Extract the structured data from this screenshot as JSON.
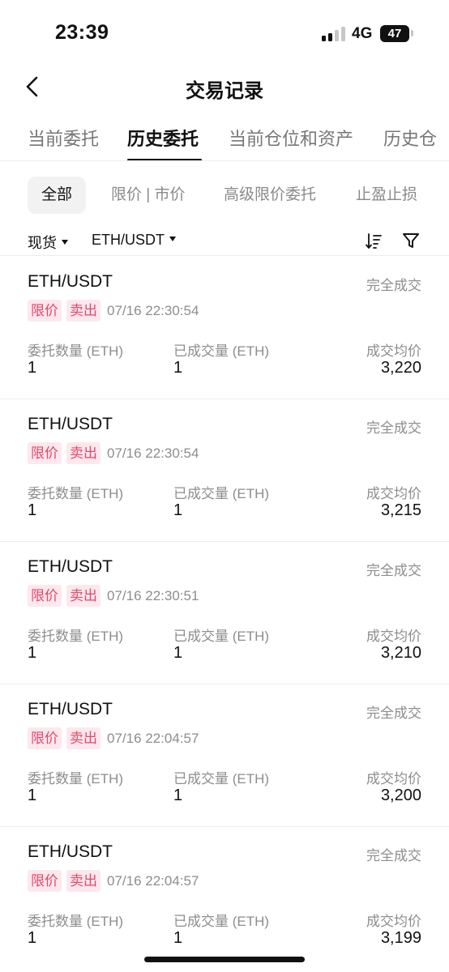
{
  "status_bar": {
    "time": "23:39",
    "network": "4G",
    "battery": "47",
    "signal_bars_active": 2,
    "signal_bars_total": 4
  },
  "nav": {
    "title": "交易记录",
    "back_icon": "chevron-left-icon"
  },
  "tabs": [
    {
      "label": "当前委托",
      "active": false
    },
    {
      "label": "历史委托",
      "active": true
    },
    {
      "label": "当前仓位和资产",
      "active": false
    },
    {
      "label": "历史仓",
      "active": false
    }
  ],
  "subtabs": [
    {
      "label": "全部",
      "active": true
    },
    {
      "label": "限价 | 市价",
      "active": false
    },
    {
      "label": "高级限价委托",
      "active": false
    },
    {
      "label": "止盈止损",
      "active": false
    }
  ],
  "filters": {
    "market": "现货",
    "pair": "ETH/USDT",
    "sort_icon": "sort-icon",
    "filter_icon": "filter-funnel-icon"
  },
  "colors": {
    "tag_bg": "#fde8ee",
    "tag_text": "#e2486c",
    "muted_text": "#8d8d8d",
    "primary_text": "#111111"
  },
  "labels": {
    "qty": "委托数量 (ETH)",
    "filled": "已成交量 (ETH)",
    "avg_price": "成交均价"
  },
  "orders": [
    {
      "pair": "ETH/USDT",
      "status": "完全成交",
      "type": "限价",
      "side": "卖出",
      "datetime": "07/16 22:30:54",
      "qty": "1",
      "filled": "1",
      "avg_price": "3,220"
    },
    {
      "pair": "ETH/USDT",
      "status": "完全成交",
      "type": "限价",
      "side": "卖出",
      "datetime": "07/16 22:30:54",
      "qty": "1",
      "filled": "1",
      "avg_price": "3,215"
    },
    {
      "pair": "ETH/USDT",
      "status": "完全成交",
      "type": "限价",
      "side": "卖出",
      "datetime": "07/16 22:30:51",
      "qty": "1",
      "filled": "1",
      "avg_price": "3,210"
    },
    {
      "pair": "ETH/USDT",
      "status": "完全成交",
      "type": "限价",
      "side": "卖出",
      "datetime": "07/16 22:04:57",
      "qty": "1",
      "filled": "1",
      "avg_price": "3,200"
    },
    {
      "pair": "ETH/USDT",
      "status": "完全成交",
      "type": "限价",
      "side": "卖出",
      "datetime": "07/16 22:04:57",
      "qty": "1",
      "filled": "1",
      "avg_price": "3,199"
    }
  ]
}
